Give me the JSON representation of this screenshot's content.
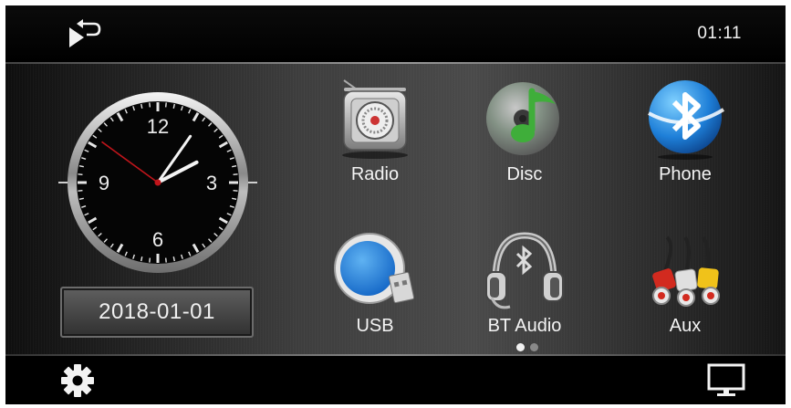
{
  "status_bar": {
    "back_icon": "back-return-icon",
    "time": "01:11"
  },
  "clock": {
    "numerals": {
      "n12": "12",
      "n3": "3",
      "n6": "6",
      "n9": "9"
    },
    "time_shown": "2:05:51"
  },
  "date": "2018-01-01",
  "apps": [
    {
      "label": "Radio",
      "icon": "radio-icon"
    },
    {
      "label": "Disc",
      "icon": "disc-music-icon"
    },
    {
      "label": "Phone",
      "icon": "bluetooth-phone-icon"
    },
    {
      "label": "USB",
      "icon": "usb-drive-icon"
    },
    {
      "label": "BT Audio",
      "icon": "bluetooth-headphones-icon"
    },
    {
      "label": "Aux",
      "icon": "rca-cables-icon"
    }
  ],
  "pager": {
    "pages": 2,
    "current": 1
  },
  "bottom_bar": {
    "settings_icon": "gear-icon",
    "display_icon": "monitor-icon"
  },
  "colors": {
    "background": "#050505",
    "text": "#f2f2f2",
    "second_hand": "#c0151b",
    "accent_blue": "#1e7fd8"
  }
}
